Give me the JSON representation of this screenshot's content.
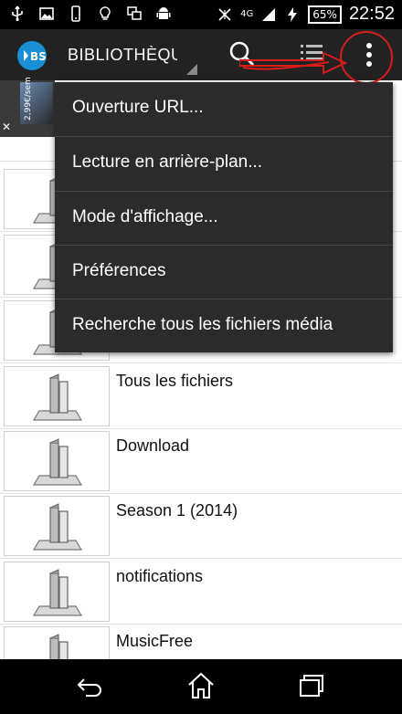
{
  "status_bar": {
    "network": "4G",
    "battery": "65%",
    "time": "22:52"
  },
  "action_bar": {
    "title": "BIBLIOTHÈQUE",
    "logo_text": "BS"
  },
  "ad": {
    "price": "2,99€/sem",
    "close": "✕"
  },
  "menu": {
    "items": [
      {
        "label": "Ouverture URL..."
      },
      {
        "label": "Lecture en arrière-plan..."
      },
      {
        "label": "Mode d'affichage..."
      },
      {
        "label": "Préférences"
      },
      {
        "label": "Recherche tous les fichiers média"
      }
    ]
  },
  "folders": [
    {
      "label": ""
    },
    {
      "label": ""
    },
    {
      "label": ""
    },
    {
      "label": "Tous les fichiers"
    },
    {
      "label": "Download"
    },
    {
      "label": "Season 1 (2014)"
    },
    {
      "label": "notifications"
    },
    {
      "label": "MusicFree"
    }
  ],
  "colors": {
    "action_bar": "#222222",
    "menu_bg": "#2b2b2b",
    "annotation": "#d81b1b",
    "logo": "#1a8fd6"
  },
  "icons": [
    "usb-icon",
    "image-icon",
    "phone-icon",
    "lightbulb-icon",
    "screen-icon",
    "android-icon",
    "signal-off-icon",
    "network-icon",
    "signal-icon",
    "charging-icon",
    "battery-icon",
    "search-icon",
    "list-icon",
    "overflow-menu-icon",
    "folder-icon",
    "back-icon",
    "home-icon",
    "recent-apps-icon"
  ]
}
